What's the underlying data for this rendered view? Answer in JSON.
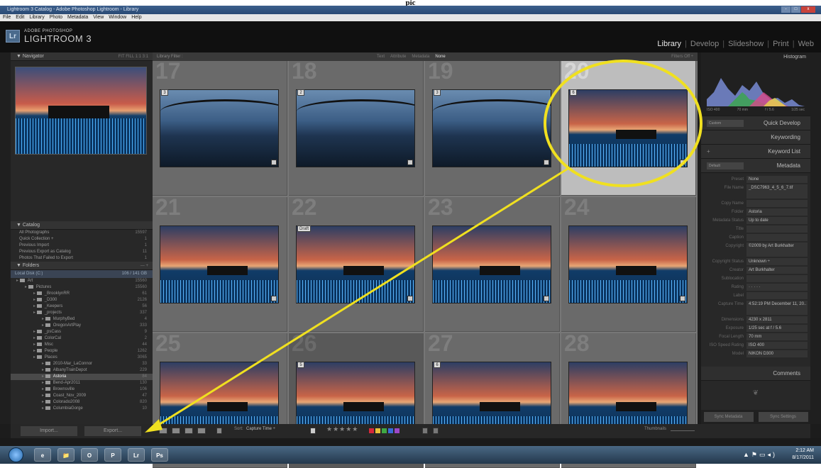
{
  "heading_fragment": "pic",
  "window": {
    "title": "Lightroom 3 Catalog - Adobe Photoshop Lightroom - Library",
    "controls": [
      "-",
      "□",
      "x"
    ]
  },
  "menu": [
    "File",
    "Edit",
    "Library",
    "Photo",
    "Metadata",
    "View",
    "Window",
    "Help"
  ],
  "identity": {
    "logo": "Lr",
    "brand_small": "ADOBE PHOTOSHOP",
    "brand_large": "LIGHTROOM 3",
    "modules": [
      {
        "label": "Library",
        "active": true
      },
      {
        "label": "Develop",
        "active": false
      },
      {
        "label": "Slideshow",
        "active": false
      },
      {
        "label": "Print",
        "active": false
      },
      {
        "label": "Web",
        "active": false
      }
    ]
  },
  "left_panel": {
    "navigator": {
      "title": "Navigator",
      "zoom_options": "FIT FILL 1:1 3:1"
    },
    "catalog": {
      "title": "Catalog",
      "items": [
        {
          "label": "All Photographs",
          "count": "15597"
        },
        {
          "label": "Quick Collection +",
          "count": "1"
        },
        {
          "label": "Previous Import",
          "count": "1"
        },
        {
          "label": "Previous Export as Catalog",
          "count": "11"
        },
        {
          "label": "Photos That Failed to Export",
          "count": "1"
        }
      ]
    },
    "folders": {
      "title": "Folders",
      "controls": "— +",
      "disk": {
        "label": "Local Disk (C:)",
        "info": "106 / 141 GB"
      },
      "items": [
        {
          "label": "Art",
          "count": "15560",
          "depth": 0,
          "selected": false
        },
        {
          "label": "Pictures",
          "count": "15560",
          "depth": 1,
          "selected": false
        },
        {
          "label": "_BrooklynRR",
          "count": "61",
          "depth": 2,
          "selected": false
        },
        {
          "label": "_D300",
          "count": "2126",
          "depth": 2,
          "selected": false
        },
        {
          "label": "_Keepers",
          "count": "56",
          "depth": 2,
          "selected": false
        },
        {
          "label": "_projects",
          "count": "337",
          "depth": 2,
          "selected": false
        },
        {
          "label": "MurphyBed",
          "count": "4",
          "depth": 3,
          "selected": false
        },
        {
          "label": "OregonArtPlay",
          "count": "333",
          "depth": 3,
          "selected": false
        },
        {
          "label": "_psCass",
          "count": "9",
          "depth": 2,
          "selected": false
        },
        {
          "label": "ColorCal",
          "count": "2",
          "depth": 2,
          "selected": false
        },
        {
          "label": "Misc",
          "count": "44",
          "depth": 2,
          "selected": false
        },
        {
          "label": "People",
          "count": "1262",
          "depth": 2,
          "selected": false
        },
        {
          "label": "Places",
          "count": "3065",
          "depth": 2,
          "selected": false
        },
        {
          "label": "2010-Mar_LaConnor",
          "count": "33",
          "depth": 3,
          "selected": false
        },
        {
          "label": "AlbanyTrainDepot",
          "count": "229",
          "depth": 3,
          "selected": false
        },
        {
          "label": "Astoria",
          "count": "84",
          "depth": 3,
          "selected": true
        },
        {
          "label": "Bend-Apr2011",
          "count": "130",
          "depth": 3,
          "selected": false
        },
        {
          "label": "Brownsville",
          "count": "106",
          "depth": 3,
          "selected": false
        },
        {
          "label": "Coast_Nov_2009",
          "count": "47",
          "depth": 3,
          "selected": false
        },
        {
          "label": "Colorado2008",
          "count": "820",
          "depth": 3,
          "selected": false
        },
        {
          "label": "ColumbiaGorge",
          "count": "10",
          "depth": 3,
          "selected": false
        }
      ]
    },
    "import_label": "Import...",
    "export_label": "Export..."
  },
  "library_filter": {
    "title": "Library Filter :",
    "tabs": [
      {
        "label": "Text",
        "on": false
      },
      {
        "label": "Attribute",
        "on": false
      },
      {
        "label": "Metadata",
        "on": false
      },
      {
        "label": "None",
        "on": true
      }
    ],
    "filters_off": "Filters Off ÷"
  },
  "grid": {
    "cells": [
      {
        "num": "17",
        "badge": "3",
        "type": "bridge",
        "hl": false,
        "dk": false
      },
      {
        "num": "18",
        "badge": "2",
        "type": "bridge",
        "hl": false,
        "dk": false
      },
      {
        "num": "19",
        "badge": "3",
        "type": "bridge",
        "hl": false,
        "dk": false
      },
      {
        "num": "20",
        "badge": "6",
        "type": "pier",
        "hl": true,
        "dk": false
      },
      {
        "num": "21",
        "badge": "",
        "type": "pier",
        "hl": false,
        "dk": false
      },
      {
        "num": "22",
        "badge": "Draft",
        "type": "pier",
        "hl": false,
        "dk": false
      },
      {
        "num": "23",
        "badge": "",
        "type": "pier",
        "hl": false,
        "dk": false
      },
      {
        "num": "24",
        "badge": "",
        "type": "pier",
        "hl": false,
        "dk": false
      },
      {
        "num": "25",
        "badge": "",
        "type": "pier",
        "hl": false,
        "dk": false
      },
      {
        "num": "26",
        "badge": "5",
        "type": "pier",
        "hl": false,
        "dk": true
      },
      {
        "num": "27",
        "badge": "6",
        "type": "pier",
        "hl": false,
        "dk": false
      },
      {
        "num": "28",
        "badge": "",
        "type": "pier",
        "hl": false,
        "dk": false
      }
    ]
  },
  "toolbar": {
    "sort_label": "Sort:",
    "sort_value": "Capture Time ÷",
    "stars": "★★★★★",
    "color_labels": [
      "#d6283a",
      "#e8c23a",
      "#3fa844",
      "#3a6ad8",
      "#9d48c8"
    ],
    "thumbnails_label": "Thumbnails"
  },
  "right_panel": {
    "histogram": {
      "title": "Histogram",
      "iso": "ISO 400",
      "focal": "70 mm",
      "aperture": "f / 5.6",
      "shutter": "1/25 sec"
    },
    "quick_develop": {
      "preset": "Custom",
      "title": "Quick Develop"
    },
    "keywording_title": "Keywording",
    "keyword_list_title": "Keyword List",
    "metadata": {
      "preset_selector": "Default",
      "title": "Metadata",
      "fields": [
        {
          "key": "Preset",
          "value": "None",
          "tall": false
        },
        {
          "key": "File Name",
          "value": "_DSC7963_4_5_6_7.tif",
          "tall": true
        },
        {
          "key": "Copy Name",
          "value": "",
          "tall": false
        },
        {
          "key": "Folder",
          "value": "Astoria",
          "tall": false
        },
        {
          "key": "Metadata Status",
          "value": "Up to date",
          "tall": false
        },
        {
          "key": "Title",
          "value": "",
          "tall": false
        },
        {
          "key": "Caption",
          "value": "",
          "tall": false
        },
        {
          "key": "Copyright",
          "value": "©2009 by Art Burkhalter",
          "tall": true
        },
        {
          "key": "Copyright Status",
          "value": "Unknown ÷",
          "tall": false
        },
        {
          "key": "Creator",
          "value": "Art Burkhalter",
          "tall": false
        },
        {
          "key": "Sublocation",
          "value": "",
          "tall": false
        },
        {
          "key": "Rating",
          "value": "· · · · ·",
          "tall": false
        },
        {
          "key": "Label",
          "value": "",
          "tall": false
        },
        {
          "key": "Capture Time",
          "value": "4:52:19 PM December 11, 20..",
          "tall": true
        },
        {
          "key": "Dimensions",
          "value": "4230 x 2811",
          "tall": false
        },
        {
          "key": "Exposure",
          "value": "1/25 sec at f / 5.6",
          "tall": false
        },
        {
          "key": "Focal Length",
          "value": "70 mm",
          "tall": false
        },
        {
          "key": "ISO Speed Rating",
          "value": "ISO 400",
          "tall": false
        },
        {
          "key": "Model",
          "value": "NIKON D300",
          "tall": false
        }
      ]
    },
    "comments_title": "Comments",
    "sync_metadata": "Sync Metadata",
    "sync_settings": "Sync Settings"
  },
  "taskbar": {
    "apps": [
      "e",
      "📁",
      "O",
      "P",
      "Lr",
      "Ps"
    ],
    "time": "2:12 AM",
    "date": "8/17/2011"
  },
  "annotation_color": "#f0e020"
}
